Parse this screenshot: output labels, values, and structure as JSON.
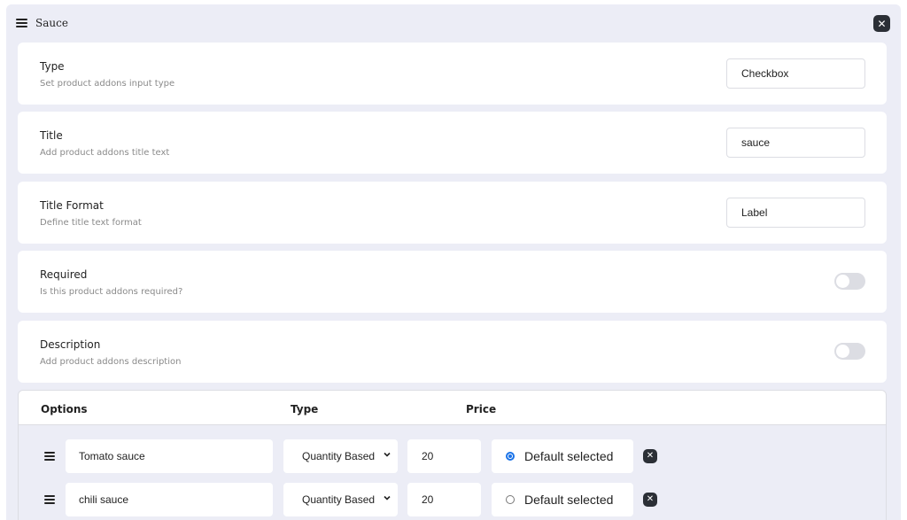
{
  "header": {
    "title": "Sauce"
  },
  "fields": [
    {
      "title": "Type",
      "description": "Set product addons input type",
      "value": "Checkbox",
      "control": "input"
    },
    {
      "title": "Title",
      "description": "Add product addons title text",
      "value": "sauce",
      "control": "input"
    },
    {
      "title": "Title Format",
      "description": "Define title text format",
      "value": "Label",
      "control": "input"
    },
    {
      "title": "Required",
      "description": "Is this product addons required?",
      "control": "toggle",
      "on": false
    },
    {
      "title": "Description",
      "description": "Add product addons description",
      "control": "toggle",
      "on": false
    }
  ],
  "options": {
    "headers": {
      "options": "Options",
      "type": "Type",
      "price": "Price"
    },
    "rows": [
      {
        "name": "Tomato sauce",
        "type": "Quantity Based",
        "price": "20",
        "default_label": "Default selected",
        "default_checked": true
      },
      {
        "name": "chili sauce",
        "type": "Quantity Based",
        "price": "20",
        "default_label": "Default selected",
        "default_checked": false
      }
    ]
  },
  "icons": {
    "menu": "hamburger-icon",
    "close": "close-icon",
    "drag": "drag-handle-icon",
    "remove": "remove-icon",
    "dropdown": "chevron-down-icon"
  },
  "colors": {
    "panel_bg": "#ecedf6",
    "card_bg": "#ffffff",
    "accent": "#1a73e8",
    "dark_button": "#2b2f36"
  }
}
